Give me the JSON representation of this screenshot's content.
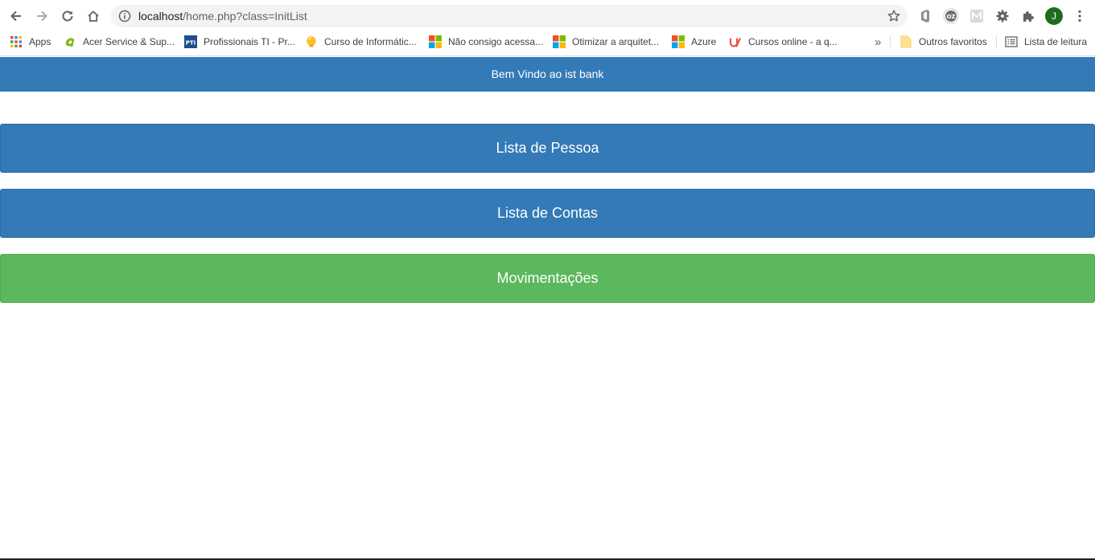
{
  "browser": {
    "url_host": "localhost",
    "url_path": "/home.php?class=InitList",
    "profile_initial": "J",
    "icons": {
      "back": "back-arrow-icon",
      "forward": "forward-arrow-icon",
      "reload": "reload-icon",
      "home": "home-icon",
      "site_info": "info-icon",
      "bookmark_star": "star-icon",
      "extensions": "puzzle-icon",
      "menu": "kebab-menu-icon"
    }
  },
  "bookmarks": {
    "items": [
      {
        "label": "Apps",
        "icon": "apps-grid-icon"
      },
      {
        "label": "Acer Service & Sup...",
        "icon": "acer-icon"
      },
      {
        "label": "Profissionais TI - Pr...",
        "icon": "pti-icon"
      },
      {
        "label": "Curso de Informátic...",
        "icon": "lightbulb-icon"
      },
      {
        "label": "Não consigo acessa...",
        "icon": "microsoft-icon"
      },
      {
        "label": "Otimizar a arquitet...",
        "icon": "microsoft-icon"
      },
      {
        "label": "Azure",
        "icon": "microsoft-icon"
      },
      {
        "label": "Cursos online - a q...",
        "icon": "udemy-icon"
      }
    ],
    "overflow_label": "»",
    "other_favorites": "Outros favoritos",
    "reading_list": "Lista de leitura"
  },
  "page": {
    "welcome_text": "Bem Vindo ao ist bank",
    "buttons": [
      {
        "label": "Lista de Pessoa",
        "color": "#337ab7"
      },
      {
        "label": "Lista de Contas",
        "color": "#337ab7"
      },
      {
        "label": "Movimentações",
        "color": "#5cb85c"
      }
    ]
  },
  "colors": {
    "primary": "#337ab7",
    "success": "#5cb85c"
  }
}
